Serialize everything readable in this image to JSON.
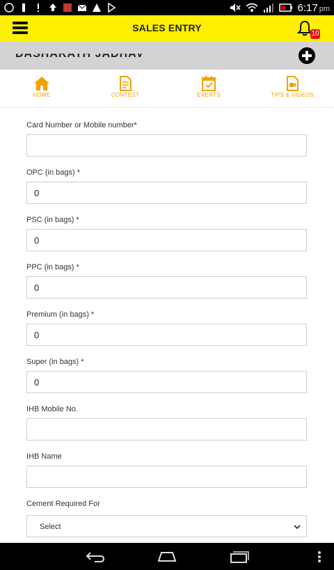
{
  "status_bar": {
    "time": "6:17",
    "ampm": "pm"
  },
  "app_bar": {
    "title": "SALES ENTRY",
    "notification_count": "10"
  },
  "user": {
    "name": "DASHARATH JADHAV"
  },
  "nav_tabs": [
    {
      "label": "HOME",
      "icon": "home-icon"
    },
    {
      "label": "CONTEST",
      "icon": "document-icon"
    },
    {
      "label": "EVENTS",
      "icon": "calendar-icon"
    },
    {
      "label": "TIPS & VIDEOS",
      "icon": "video-icon"
    }
  ],
  "form": {
    "card_number": {
      "label": "Card Number or Mobile number*",
      "value": ""
    },
    "opc": {
      "label": "OPC (in bags) *",
      "value": "0"
    },
    "psc": {
      "label": "PSC (in bags) *",
      "value": "0"
    },
    "ppc": {
      "label": "PPC (in bags) *",
      "value": "0"
    },
    "premium": {
      "label": "Premium (in bags) *",
      "value": "0"
    },
    "super": {
      "label": "Super (in bags) *",
      "value": "0"
    },
    "ihb_mobile": {
      "label": "IHB Mobile No.",
      "value": ""
    },
    "ihb_name": {
      "label": "IHB Name",
      "value": ""
    },
    "cement_required": {
      "label": "Cement Required For",
      "selected": "Select"
    }
  },
  "colors": {
    "app_bar": "#ffef00",
    "tab_accent": "#f5a000",
    "badge": "#e3111a",
    "user_strip": "#d3d3d3"
  }
}
